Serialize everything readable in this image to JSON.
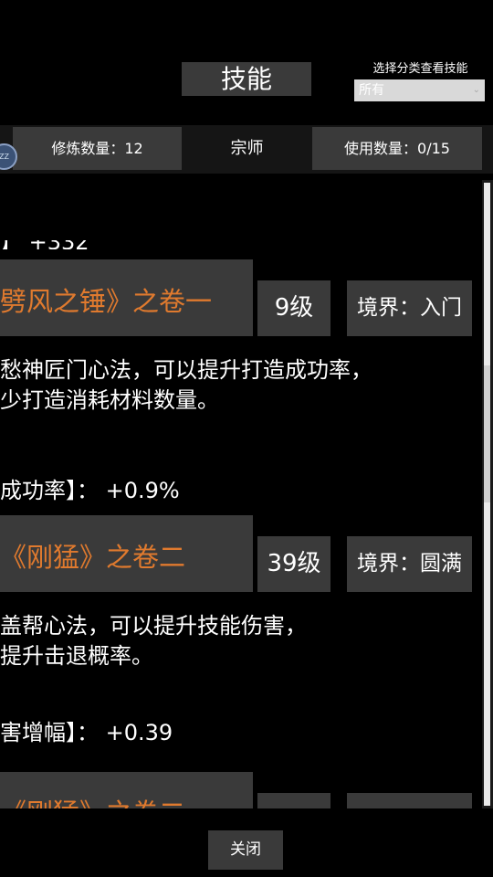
{
  "header": {
    "title": "技能",
    "filter_label": "选择分类查看技能",
    "filter_value": "所有"
  },
  "stats": {
    "cultivate_count": "修炼数量：12",
    "rank": "宗师",
    "use_count": "使用数量：0/15"
  },
  "skills": [
    {
      "title": "劈风之锤》之卷一",
      "level": "9级",
      "realm": "境界：入门",
      "desc_line1": "愁神匠门心法，可以提升打造成功率，",
      "desc_line2": "少打造消耗材料数量。",
      "stat1": "成功率】：  +0.9%"
    },
    {
      "title": "《刚猛》之卷二",
      "level": "39级",
      "realm": "境界：圆满",
      "desc_line1": "盖帮心法，可以提升技能伤害，",
      "desc_line2": "提升击退概率。",
      "stat1": "害增幅】：   +0.39"
    },
    {
      "title": "《刚猛》之卷二"
    }
  ],
  "footer": {
    "close_label": "关闭"
  }
}
